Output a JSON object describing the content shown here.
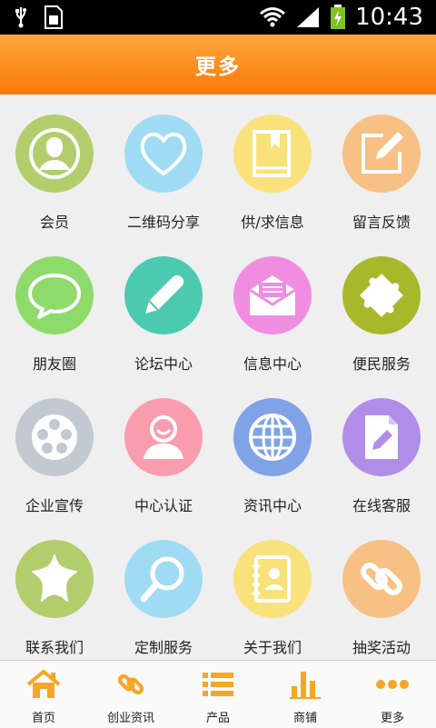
{
  "status_bar": {
    "time": "10:43"
  },
  "header": {
    "title": "更多"
  },
  "grid": [
    {
      "label": "会员",
      "icon": "member-icon",
      "color": "#b3cd6d"
    },
    {
      "label": "二维码分享",
      "icon": "heart-icon",
      "color": "#9fdcf4"
    },
    {
      "label": "供/求信息",
      "icon": "book-icon",
      "color": "#f9e27c"
    },
    {
      "label": "留言反馈",
      "icon": "edit-note-icon",
      "color": "#f7c084"
    },
    {
      "label": "朋友圈",
      "icon": "chat-bubble-icon",
      "color": "#8edb6c"
    },
    {
      "label": "论坛中心",
      "icon": "pencil-icon",
      "color": "#4bcab0"
    },
    {
      "label": "信息中心",
      "icon": "envelope-icon",
      "color": "#f08de1"
    },
    {
      "label": "便民服务",
      "icon": "puzzle-icon",
      "color": "#a8b82b"
    },
    {
      "label": "企业宣传",
      "icon": "film-reel-icon",
      "color": "#c2c9d1"
    },
    {
      "label": "中心认证",
      "icon": "user-icon",
      "color": "#f99dae"
    },
    {
      "label": "资讯中心",
      "icon": "globe-icon",
      "color": "#7fa3e6"
    },
    {
      "label": "在线客服",
      "icon": "document-edit-icon",
      "color": "#b18de9"
    },
    {
      "label": "联系我们",
      "icon": "star-icon",
      "color": "#b3cd6d"
    },
    {
      "label": "定制服务",
      "icon": "magnifier-icon",
      "color": "#9fdcf4"
    },
    {
      "label": "关于我们",
      "icon": "contacts-book-icon",
      "color": "#f9e27c"
    },
    {
      "label": "抽奖活动",
      "icon": "link-icon",
      "color": "#f7c084"
    }
  ],
  "tabbar": [
    {
      "label": "首页",
      "icon": "home-icon"
    },
    {
      "label": "创业资讯",
      "icon": "link-icon"
    },
    {
      "label": "产品",
      "icon": "list-icon"
    },
    {
      "label": "商铺",
      "icon": "bar-chart-icon"
    },
    {
      "label": "更多",
      "icon": "more-icon"
    }
  ],
  "colors": {
    "header_top": "#ffa53a",
    "header_bottom": "#f97a0b",
    "tab_accent": "#f5a623",
    "background": "#efefef"
  }
}
